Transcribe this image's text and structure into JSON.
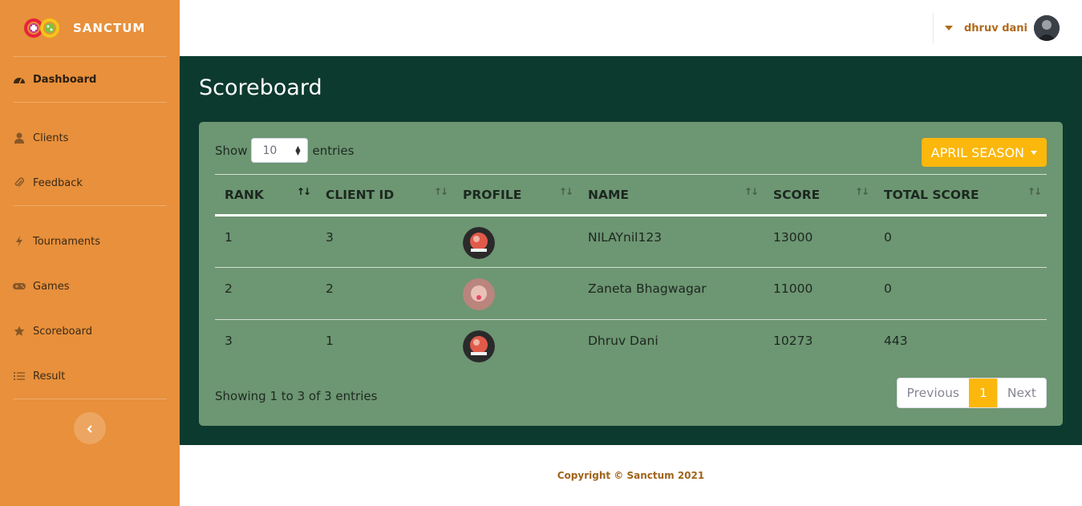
{
  "brand": {
    "name": "SANCTUM"
  },
  "sidebar": {
    "items": [
      {
        "label": "Dashboard",
        "icon": "tachometer-icon",
        "active": true
      },
      {
        "label": "Clients",
        "icon": "user-icon"
      },
      {
        "label": "Feedback",
        "icon": "paperclip-icon"
      },
      {
        "label": "Tournaments",
        "icon": "bolt-icon"
      },
      {
        "label": "Games",
        "icon": "gamepad-icon"
      },
      {
        "label": "Scoreboard",
        "icon": "star-icon"
      },
      {
        "label": "Result",
        "icon": "list-icon"
      }
    ],
    "collapse_icon": "chevron-left-icon"
  },
  "topbar": {
    "user_name": "dhruv dani"
  },
  "page": {
    "title": "Scoreboard"
  },
  "table_controls": {
    "show_label": "Show",
    "entries_value": "10",
    "entries_label": "entries",
    "season_button": "APRIL SEASON"
  },
  "table": {
    "columns": [
      "RANK",
      "CLIENT ID",
      "PROFILE",
      "NAME",
      "SCORE",
      "TOTAL SCORE"
    ],
    "rows": [
      {
        "rank": "1",
        "client_id": "3",
        "name": "NILAYnil123",
        "score": "13000",
        "total_score": "0"
      },
      {
        "rank": "2",
        "client_id": "2",
        "name": "Zaneta Bhagwagar",
        "score": "11000",
        "total_score": "0"
      },
      {
        "rank": "3",
        "client_id": "1",
        "name": "Dhruv Dani",
        "score": "10273",
        "total_score": "443"
      }
    ]
  },
  "pagination": {
    "info": "Showing 1 to 3 of 3 entries",
    "previous": "Previous",
    "current": "1",
    "next": "Next"
  },
  "footer": {
    "copyright": "Copyright © Sanctum 2021"
  },
  "colors": {
    "sidebar": "#e8903b",
    "content_bg": "#0c3a2e",
    "card_bg": "#6d9672",
    "accent": "#fbb70b"
  }
}
